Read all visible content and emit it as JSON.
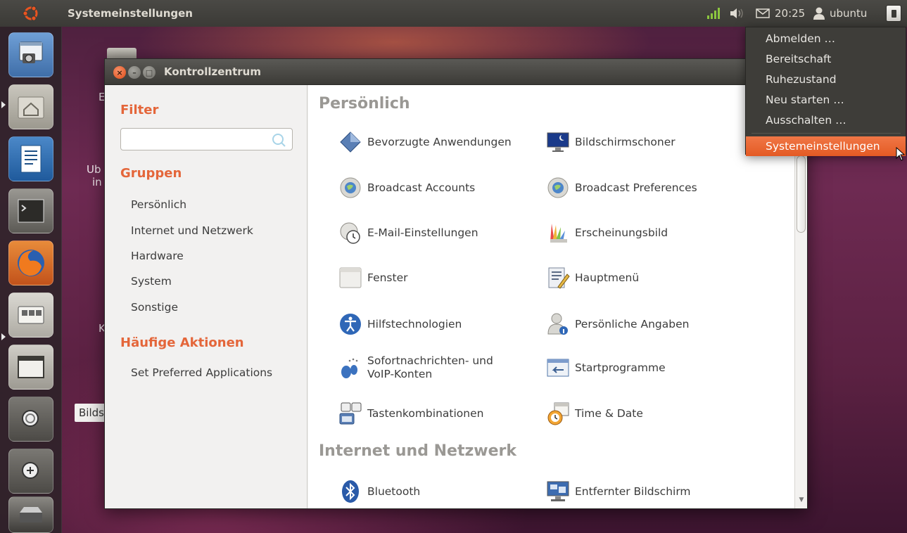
{
  "top_panel": {
    "app_title": "Systemeinstellungen",
    "clock": "20:25",
    "user": "ubuntu"
  },
  "launcher": {
    "items": [
      "system-settings-icon",
      "home-folder-icon",
      "writer-icon",
      "terminal-icon",
      "firefox-icon",
      "control-center-icon",
      "window-icon",
      "zoom-out-icon",
      "zoom-in-icon",
      "drive-icon"
    ]
  },
  "desktop": {
    "tooltip": "Bilds"
  },
  "window": {
    "title": "Kontrollzentrum",
    "close_symbol": "×",
    "minimize_symbol": "–",
    "maximize_symbol": "□",
    "sidebar": {
      "filter_heading": "Filter",
      "filter_value": "",
      "groups_heading": "Gruppen",
      "groups": [
        "Persönlich",
        "Internet und Netzwerk",
        "Hardware",
        "System",
        "Sonstige"
      ],
      "actions_heading": "Häufige Aktionen",
      "actions": [
        "Set Preferred Applications"
      ]
    },
    "content": {
      "sections": [
        {
          "title": "Persönlich",
          "items": [
            {
              "label": "Bevorzugte Anwendungen",
              "icon": "preferred-apps-icon"
            },
            {
              "label": "Bildschirmschoner",
              "icon": "screensaver-icon"
            },
            {
              "label": "Broadcast Accounts",
              "icon": "broadcast-icon"
            },
            {
              "label": "Broadcast Preferences",
              "icon": "broadcast-icon"
            },
            {
              "label": "E-Mail-Einstellungen",
              "icon": "mail-settings-icon"
            },
            {
              "label": "Erscheinungsbild",
              "icon": "appearance-icon"
            },
            {
              "label": "Fenster",
              "icon": "window-icon"
            },
            {
              "label": "Hauptmenü",
              "icon": "main-menu-icon"
            },
            {
              "label": "Hilfstechnologien",
              "icon": "accessibility-icon"
            },
            {
              "label": "Persönliche Angaben",
              "icon": "about-me-icon"
            },
            {
              "label": "Sofortnachrichten- und VoIP-Konten",
              "icon": "messaging-icon"
            },
            {
              "label": "Startprogramme",
              "icon": "startup-icon"
            },
            {
              "label": "Tastenkombinationen",
              "icon": "keyboard-shortcuts-icon"
            },
            {
              "label": "Time & Date",
              "icon": "time-date-icon"
            }
          ]
        },
        {
          "title": "Internet und Netzwerk",
          "items": [
            {
              "label": "Bluetooth",
              "icon": "bluetooth-icon"
            },
            {
              "label": "Entfernter Bildschirm",
              "icon": "remote-desktop-icon"
            }
          ]
        }
      ]
    }
  },
  "session_menu": {
    "items": [
      "Abmelden …",
      "Bereitschaft",
      "Ruhezustand",
      "Neu starten …",
      "Ausschalten …"
    ],
    "settings_item": "Systemeinstellungen"
  },
  "colors": {
    "accent_orange": "#e4663a",
    "menu_highlight": "#e45a24",
    "panel_dark": "#3c3b37"
  }
}
